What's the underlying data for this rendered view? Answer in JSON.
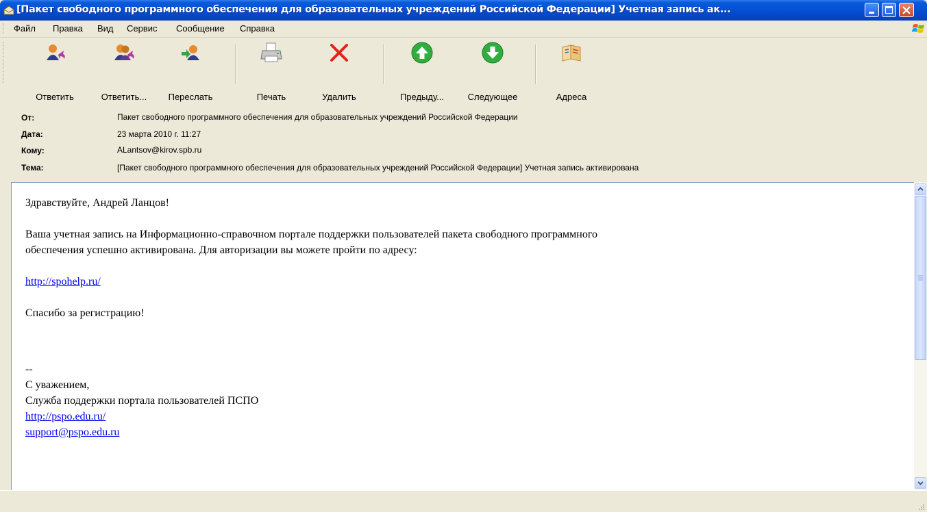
{
  "window": {
    "title": "[Пакет свободного программного обеспечения для образовательных учреждений Российской Федерации] Учетная запись ак..."
  },
  "menu": {
    "items": [
      "Файл",
      "Правка",
      "Вид",
      "Сервис",
      "Сообщение",
      "Справка"
    ]
  },
  "toolbar": {
    "reply": "Ответить",
    "reply_all": "Ответить...",
    "forward": "Переслать",
    "print": "Печать",
    "delete": "Удалить",
    "previous": "Предыду...",
    "next": "Следующее",
    "addresses": "Адреса"
  },
  "header": {
    "from_label": "От:",
    "from": "Пакет свободного программного обеспечения для образовательных учреждений Российской Федерации",
    "date_label": "Дата:",
    "date": "23 марта 2010 г. 11:27",
    "to_label": "Кому:",
    "to": "ALantsov@kirov.spb.ru",
    "subject_label": "Тема:",
    "subject": "[Пакет свободного программного обеспечения для образовательных учреждений Российской Федерации] Учетная запись активирована"
  },
  "message": {
    "greeting": "Здравствуйте, Андрей Ланцов!",
    "body_line1": "Ваша учетная запись на Информационно-справочном портале поддержки пользователей пакета свободного программного",
    "body_line2": "обеспечения успешно активирована. Для авторизации вы можете пройти по адресу:",
    "link": "http://spohelp.ru/",
    "thanks": "Спасибо за регистрацию!",
    "sig_sep": "--",
    "sig_regards": "С уважением,",
    "sig_team": "Служба поддержки портала пользователей ПСПО",
    "sig_link": "http://pspo.edu.ru/",
    "sig_email": "support@pspo.edu.ru"
  },
  "colors": {
    "titlebar": "#0453D6",
    "link": "#0000EE",
    "window_bg": "#ECE9D8"
  }
}
